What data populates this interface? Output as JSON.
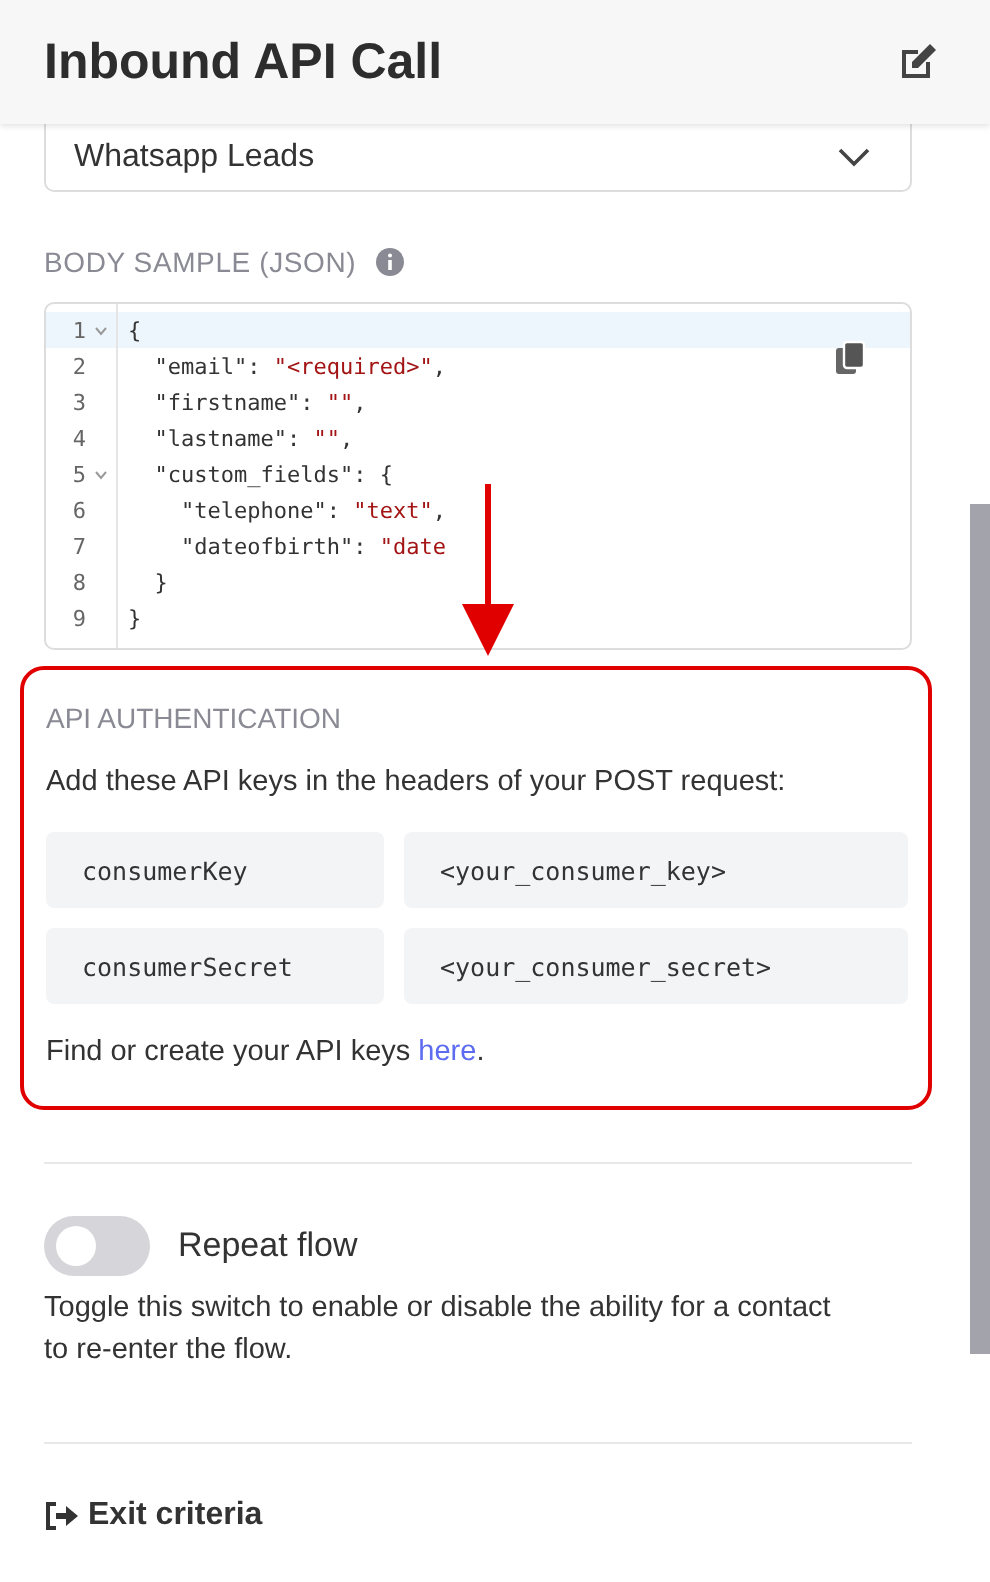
{
  "header": {
    "title": "Inbound API Call"
  },
  "dropdown": {
    "value": "Whatsapp Leads"
  },
  "body_sample": {
    "label": "BODY SAMPLE (JSON)",
    "lines": [
      {
        "number": "1",
        "foldable": true,
        "active": true,
        "parts": [
          {
            "kind": "punct",
            "text": "{"
          }
        ]
      },
      {
        "number": "2",
        "foldable": false,
        "active": false,
        "parts": [
          {
            "kind": "key",
            "text": "  \"email\": "
          },
          {
            "kind": "string",
            "text": "\"<required>\""
          },
          {
            "kind": "punct",
            "text": ","
          }
        ]
      },
      {
        "number": "3",
        "foldable": false,
        "active": false,
        "parts": [
          {
            "kind": "key",
            "text": "  \"firstname\": "
          },
          {
            "kind": "string",
            "text": "\"\""
          },
          {
            "kind": "punct",
            "text": ","
          }
        ]
      },
      {
        "number": "4",
        "foldable": false,
        "active": false,
        "parts": [
          {
            "kind": "key",
            "text": "  \"lastname\": "
          },
          {
            "kind": "string",
            "text": "\"\""
          },
          {
            "kind": "punct",
            "text": ","
          }
        ]
      },
      {
        "number": "5",
        "foldable": true,
        "active": false,
        "parts": [
          {
            "kind": "key",
            "text": "  \"custom_fields\": "
          },
          {
            "kind": "punct",
            "text": "{"
          }
        ]
      },
      {
        "number": "6",
        "foldable": false,
        "active": false,
        "parts": [
          {
            "kind": "key",
            "text": "    \"telephone\": "
          },
          {
            "kind": "string",
            "text": "\"text\""
          },
          {
            "kind": "punct",
            "text": ","
          }
        ]
      },
      {
        "number": "7",
        "foldable": false,
        "active": false,
        "parts": [
          {
            "kind": "key",
            "text": "    \"dateofbirth\": "
          },
          {
            "kind": "string",
            "text": "\"date"
          }
        ]
      },
      {
        "number": "8",
        "foldable": false,
        "active": false,
        "parts": [
          {
            "kind": "punct",
            "text": "  }"
          }
        ]
      },
      {
        "number": "9",
        "foldable": false,
        "active": false,
        "parts": [
          {
            "kind": "punct",
            "text": "}"
          }
        ]
      }
    ]
  },
  "api_authentication": {
    "title": "API AUTHENTICATION",
    "instructions": "Add these API keys in the headers of your POST request:",
    "keys": [
      {
        "name": "consumerKey",
        "value": "<your_consumer_key>"
      },
      {
        "name": "consumerSecret",
        "value": "<your_consumer_secret>"
      }
    ],
    "footer_text": "Find or create your API keys ",
    "footer_link": "here",
    "footer_end": "."
  },
  "repeat_flow": {
    "label": "Repeat flow",
    "on": false,
    "description": "Toggle this switch to enable or disable the ability for a contact to re-enter the flow."
  },
  "exit_criteria": {
    "title": "Exit criteria"
  }
}
